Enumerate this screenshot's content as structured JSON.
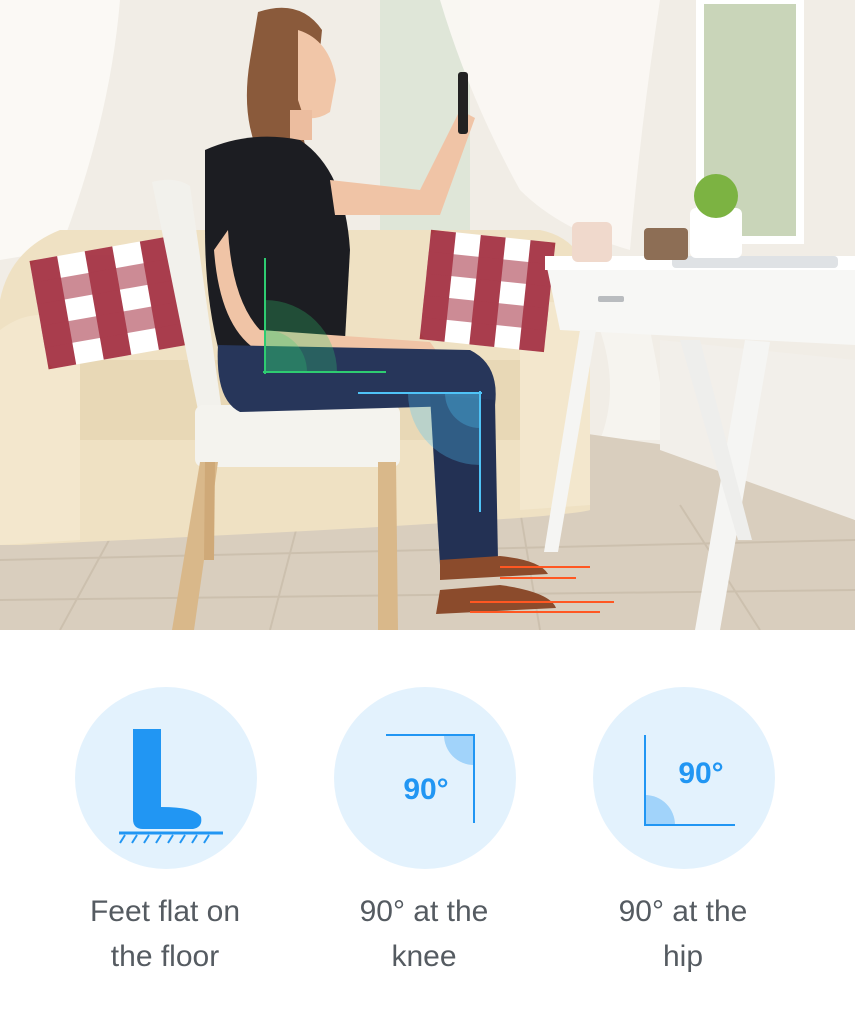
{
  "photo": {
    "icon": "seated-posture-photo"
  },
  "tips": [
    {
      "icon": "foot-flat-icon",
      "caption_line1": "Feet flat on",
      "caption_line2": "the floor"
    },
    {
      "icon": "knee-angle-icon",
      "badge": "90°",
      "caption_line1": "90° at the",
      "caption_line2": "knee"
    },
    {
      "icon": "hip-angle-icon",
      "badge": "90°",
      "caption_line1": "90° at the",
      "caption_line2": "hip"
    }
  ],
  "colors": {
    "accent_blue": "#2196f3",
    "circle_bg": "#e3f2fd",
    "hip_overlay": "#2ecc71",
    "knee_overlay": "#4fc3f7",
    "feet_overlay": "#ff5722",
    "caption_text": "#555b61"
  }
}
